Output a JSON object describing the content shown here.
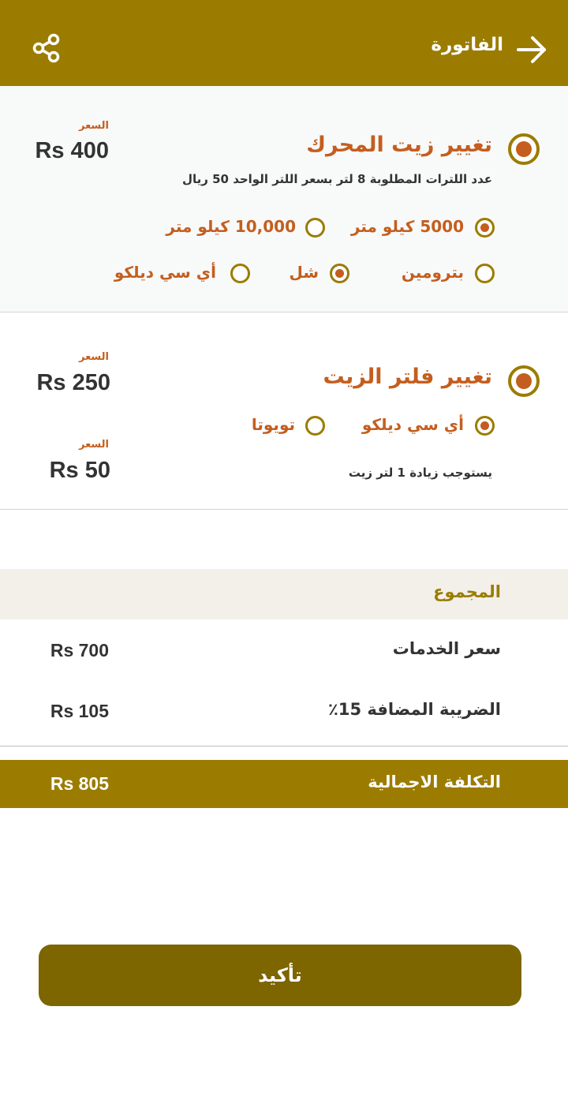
{
  "header": {
    "title": "الفاتورة",
    "back_icon": "arrow-right-icon",
    "share_icon": "share-icon"
  },
  "service_oil": {
    "title": "تغيير زيت المحرك",
    "note": "عدد اللترات المطلوبة 8 لتر بسعر اللتر الواحد 50 ريال",
    "price_label": "السعر",
    "price": "Rs 400",
    "selected": true,
    "mileage_options": [
      {
        "label": "5000 كيلو متر",
        "selected": true
      },
      {
        "label": "10,000 كيلو متر",
        "selected": false
      }
    ],
    "brand_options": [
      {
        "label": "بترومين",
        "selected": false
      },
      {
        "label": "شل",
        "selected": true
      },
      {
        "label": "أي سي ديلكو",
        "selected": false
      }
    ]
  },
  "service_filter": {
    "title": "تغيير فلتر الزيت",
    "price_label": "السعر",
    "price": "Rs 250",
    "selected": true,
    "brand_options": [
      {
        "label": "أي سي ديلكو",
        "selected": true
      },
      {
        "label": "تويوتا",
        "selected": false
      }
    ],
    "extra_note": "يستوجب زيادة 1 لتر زيت",
    "extra_price_label": "السعر",
    "extra_price": "Rs 50"
  },
  "summary": {
    "title": "المجموع",
    "services_label": "سعر الخدمات",
    "services_value": "Rs 700",
    "vat_label": "الضريبة المضافة 15٪",
    "vat_value": "Rs 105",
    "total_label": "التكلفة الاجمالية",
    "total_value": "Rs 805"
  },
  "confirm_label": "تأكيد",
  "colors": {
    "brand": "#9b7c00",
    "accent": "#c45e1e",
    "button": "#7d6500"
  }
}
